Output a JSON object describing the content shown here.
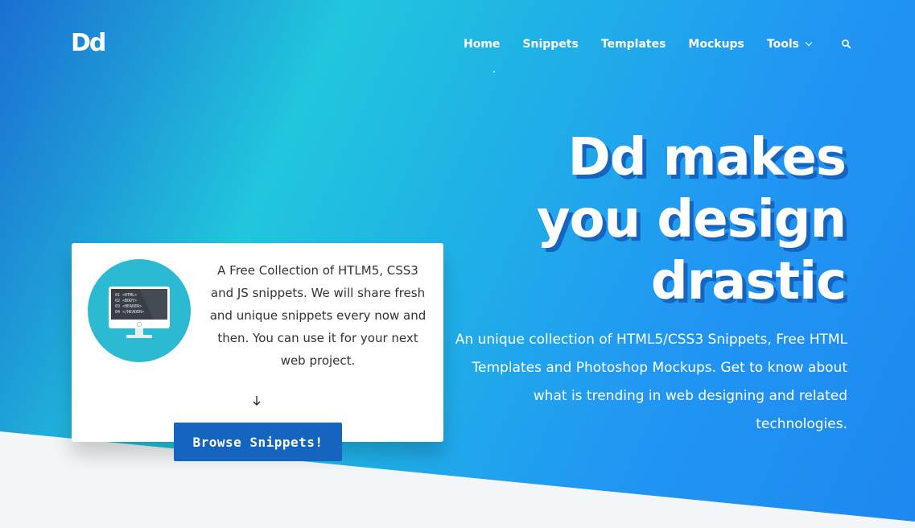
{
  "brand": {
    "logo_text": "Dd"
  },
  "nav": {
    "items": [
      {
        "label": "Home",
        "active": true
      },
      {
        "label": "Snippets"
      },
      {
        "label": "Templates"
      },
      {
        "label": "Mockups"
      },
      {
        "label": "Tools",
        "has_dropdown": true
      }
    ],
    "search_icon": "search-icon"
  },
  "hero": {
    "headline": [
      "Dd makes",
      "you design",
      "drastic"
    ],
    "subtext": "An unique collection of HTML5/CSS3 Snippets, Free HTML Templates and Photoshop Mockups. Get to know about what is trending in web designing and related technologies."
  },
  "card": {
    "illustration_code_lines": [
      "01 <HTML>",
      "02 <BODY>",
      "03 <HEADER>",
      "04 </HEADER>"
    ],
    "text": "A Free Collection of HTLM5, CSS3 and JS snippets. We will share fresh and unique snippets every now and then. You can use it for your next web project.",
    "arrow_icon": "arrow-down-icon"
  },
  "cta": {
    "label": "Browse Snippets!"
  },
  "colors": {
    "gradient_start": "#1b6fd2",
    "gradient_mid": "#21c6dc",
    "gradient_end": "#1e88f0",
    "headline_shadow": "#1565c0",
    "button": "#1565c0",
    "illustration_circle": "#2bbad1",
    "bottom_section": "#f3f6f8"
  }
}
